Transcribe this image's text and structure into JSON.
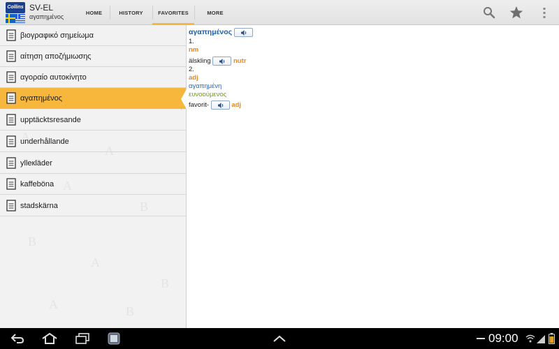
{
  "app": {
    "logo_text": "Collins",
    "title": "SV-EL",
    "subtitle": "αγαπημένος"
  },
  "tabs": [
    {
      "label": "HOME",
      "active": false
    },
    {
      "label": "HISTORY",
      "active": false
    },
    {
      "label": "FAVORITES",
      "active": true
    },
    {
      "label": "MORE",
      "active": false
    }
  ],
  "actions": {
    "search_icon": "search-icon",
    "star_icon": "star-icon",
    "overflow_icon": "overflow-menu-icon"
  },
  "favorites": [
    {
      "label": "βιογραφικό σημείωμα",
      "selected": false
    },
    {
      "label": "αίτηση αποζήμιωσης",
      "selected": false
    },
    {
      "label": "αγοραίο αυτοκίνητο",
      "selected": false
    },
    {
      "label": "αγαπημένος",
      "selected": true
    },
    {
      "label": "upptäcktsresande",
      "selected": false
    },
    {
      "label": "underhållande",
      "selected": false
    },
    {
      "label": "ylleкläder",
      "selected": false
    },
    {
      "label": "kaffeböna",
      "selected": false
    },
    {
      "label": "stadskärna",
      "selected": false
    }
  ],
  "entry": {
    "headword": "αγαπημένος",
    "sense1_number": "1.",
    "sense1_pos": "nm",
    "sense1_translation": "älskling",
    "sense1_gender": "nutr",
    "sense2_number": "2.",
    "sense2_pos": "adj",
    "sense2_form1": "αγαπημένη",
    "sense2_form2": "ευνοούμενος",
    "sense2_translation": "favorit-",
    "sense2_trans_pos": "adj"
  },
  "status": {
    "time": "09:00"
  },
  "colors": {
    "accent": "#f6b73c",
    "headword": "#1f5fa8",
    "pos": "#e8891f",
    "green": "#6f9a1c"
  }
}
